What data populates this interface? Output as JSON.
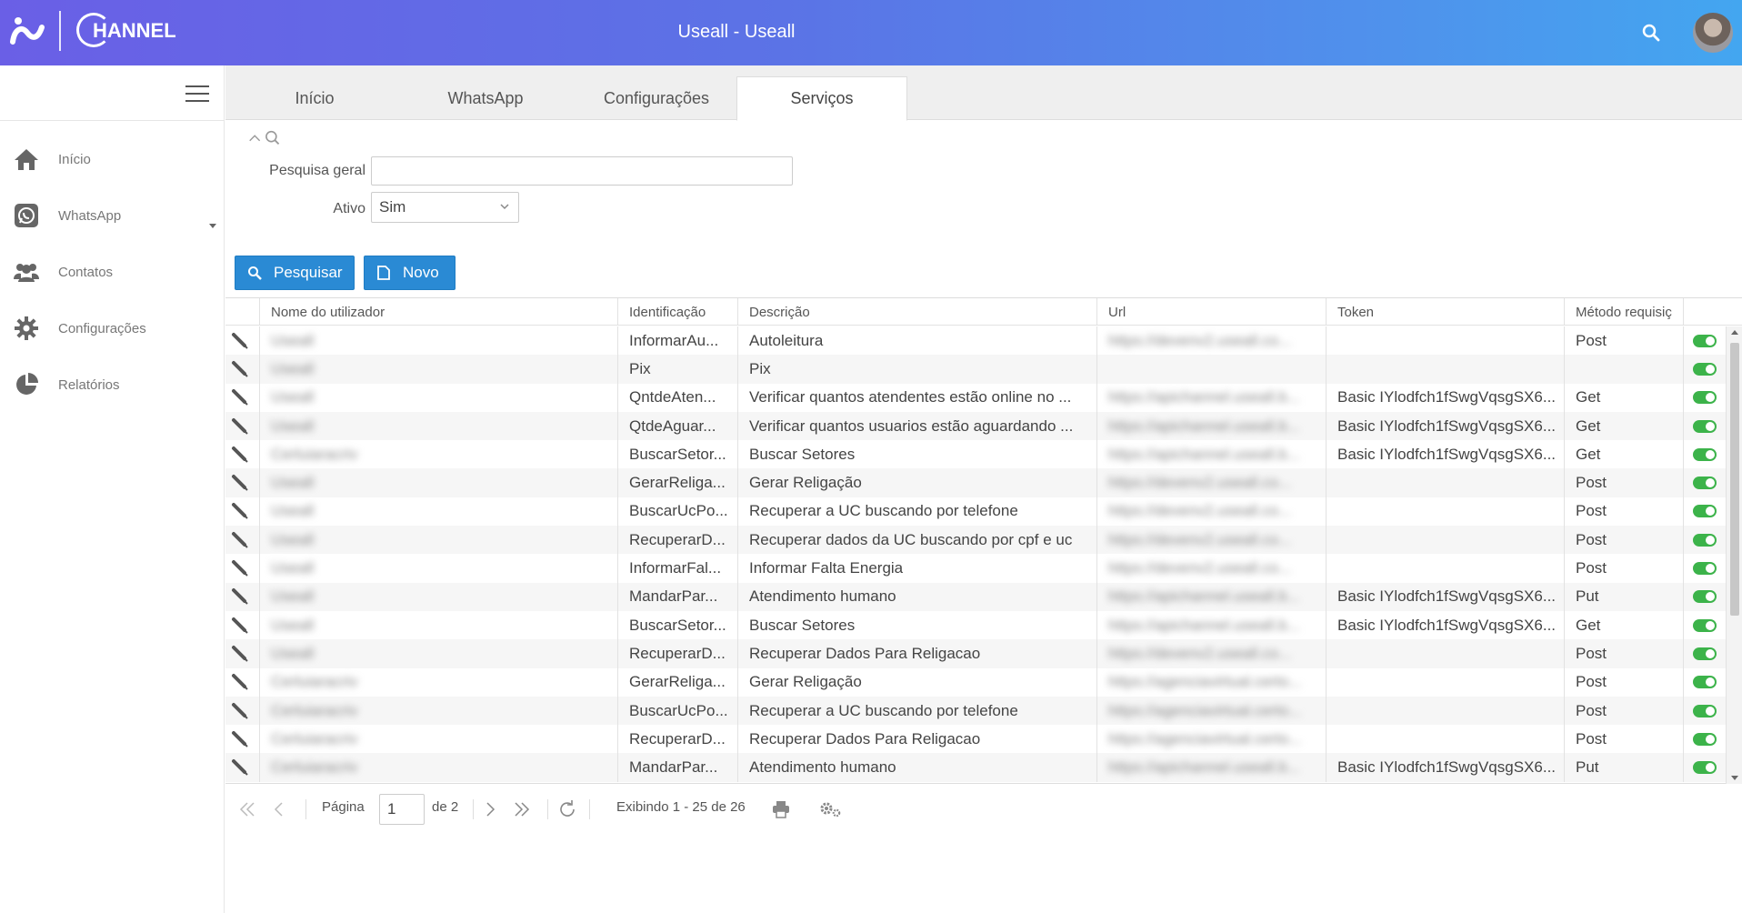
{
  "header": {
    "title": "Useall - Useall",
    "logo_text": "HANNEL",
    "search_icon": "search-icon",
    "avatar": "user-avatar"
  },
  "sidebar": {
    "menu_icon": "hamburger-icon",
    "items": [
      {
        "label": "Início",
        "icon": "home-icon"
      },
      {
        "label": "WhatsApp",
        "icon": "whatsapp-icon",
        "has_submenu": true
      },
      {
        "label": "Contatos",
        "icon": "contacts-icon"
      },
      {
        "label": "Configurações",
        "icon": "gear-icon"
      },
      {
        "label": "Relatórios",
        "icon": "pie-chart-icon"
      }
    ]
  },
  "tabs": [
    {
      "label": "Início",
      "active": false
    },
    {
      "label": "WhatsApp",
      "active": false
    },
    {
      "label": "Configurações",
      "active": false
    },
    {
      "label": "Serviços",
      "active": true
    }
  ],
  "filters": {
    "search_label": "Pesquisa geral",
    "search_value": "",
    "active_label": "Ativo",
    "active_value": "Sim"
  },
  "actions": {
    "search_label": "Pesquisar",
    "new_label": "Novo"
  },
  "grid": {
    "columns": [
      "Nome do utilizador",
      "Identificação",
      "Descrição",
      "Url",
      "Token",
      "Método requisiç"
    ],
    "rows": [
      {
        "user": "Useall",
        "id": "InformarAu...",
        "desc": "Autoleitura",
        "url": "https://devenv2.useall.co...",
        "token": "",
        "method": "Post"
      },
      {
        "user": "Useall",
        "id": "Pix",
        "desc": "Pix",
        "url": "",
        "token": "",
        "method": ""
      },
      {
        "user": "Useall",
        "id": "QntdeAten...",
        "desc": "Verificar quantos atendentes estão online no ...",
        "url": "https://apichannel.useall.b...",
        "token": "Basic IYlodfch1fSwgVqsgSX6...",
        "method": "Get"
      },
      {
        "user": "Useall",
        "id": "QtdeAguar...",
        "desc": "Verificar quantos usuarios estão aguardando ...",
        "url": "https://apichannel.useall.b...",
        "token": "Basic IYlodfch1fSwgVqsgSX6...",
        "method": "Get"
      },
      {
        "user": "Cerluiaracriv",
        "id": "BuscarSetor...",
        "desc": "Buscar Setores",
        "url": "https://apichannel.useall.b...",
        "token": "Basic IYlodfch1fSwgVqsgSX6...",
        "method": "Get"
      },
      {
        "user": "Useall",
        "id": "GerarReliga...",
        "desc": "Gerar Religação",
        "url": "https://devenv2.useall.co...",
        "token": "",
        "method": "Post"
      },
      {
        "user": "Useall",
        "id": "BuscarUcPo...",
        "desc": "Recuperar a UC buscando por telefone",
        "url": "https://devenv2.useall.co...",
        "token": "",
        "method": "Post"
      },
      {
        "user": "Useall",
        "id": "RecuperarD...",
        "desc": "Recuperar dados da UC buscando por cpf e uc",
        "url": "https://devenv2.useall.co...",
        "token": "",
        "method": "Post"
      },
      {
        "user": "Useall",
        "id": "InformarFal...",
        "desc": "Informar Falta Energia",
        "url": "https://devenv2.useall.co...",
        "token": "",
        "method": "Post"
      },
      {
        "user": "Useall",
        "id": "MandarPar...",
        "desc": "Atendimento humano",
        "url": "https://apichannel.useall.b...",
        "token": "Basic IYlodfch1fSwgVqsgSX6...",
        "method": "Put"
      },
      {
        "user": "Useall",
        "id": "BuscarSetor...",
        "desc": "Buscar Setores",
        "url": "https://apichannel.useall.b...",
        "token": "Basic IYlodfch1fSwgVqsgSX6...",
        "method": "Get"
      },
      {
        "user": "Useall",
        "id": "RecuperarD...",
        "desc": "Recuperar Dados Para Religacao",
        "url": "https://devenv2.useall.co...",
        "token": "",
        "method": "Post"
      },
      {
        "user": "Cerluiaracriv",
        "id": "GerarReliga...",
        "desc": "Gerar Religação",
        "url": "https://agenciavirtual.certo...",
        "token": "",
        "method": "Post"
      },
      {
        "user": "Cerluiaracriv",
        "id": "BuscarUcPo...",
        "desc": "Recuperar a UC buscando por telefone",
        "url": "https://agenciavirtual.certo...",
        "token": "",
        "method": "Post"
      },
      {
        "user": "Cerluiaracriv",
        "id": "RecuperarD...",
        "desc": "Recuperar Dados Para Religacao",
        "url": "https://agenciavirtual.certo...",
        "token": "",
        "method": "Post"
      },
      {
        "user": "Cerluiaracriv",
        "id": "MandarPar...",
        "desc": "Atendimento humano",
        "url": "https://apichannel.useall.b...",
        "token": "Basic IYlodfch1fSwgVqsgSX6...",
        "method": "Put"
      }
    ]
  },
  "pager": {
    "page_label": "Página",
    "page_value": "1",
    "total_label": "de 2",
    "showing": "Exibindo 1 - 25 de 26"
  },
  "colors": {
    "header_start": "#6a5fe6",
    "header_end": "#43a6f0",
    "button": "#2a8ad4",
    "toggle_on": "#3cb34a"
  }
}
